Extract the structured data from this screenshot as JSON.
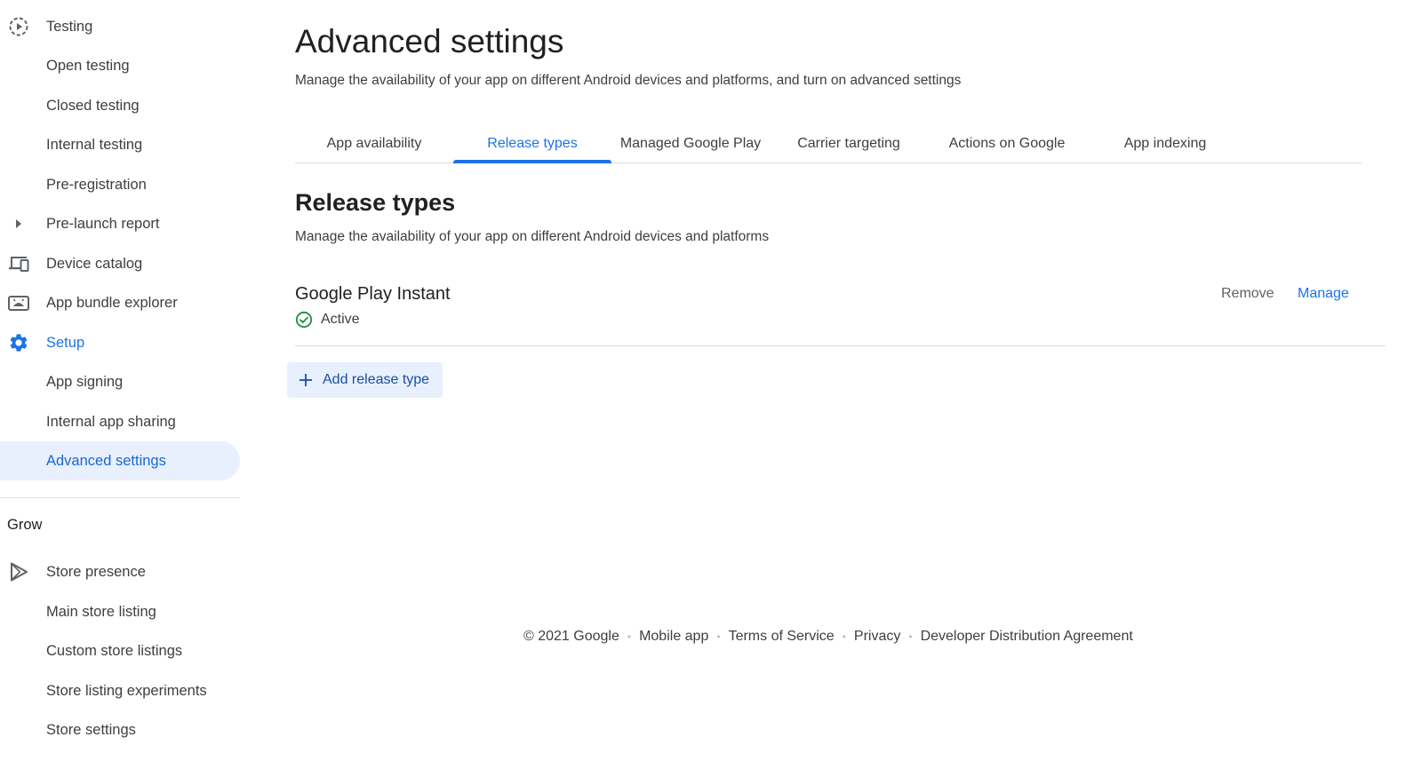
{
  "sidebar": {
    "items": [
      {
        "label": "Testing",
        "icon": "testing-play-icon"
      },
      {
        "label": "Open testing"
      },
      {
        "label": "Closed testing"
      },
      {
        "label": "Internal testing"
      },
      {
        "label": "Pre-registration"
      },
      {
        "label": "Pre-launch report",
        "icon": "caret-right-icon"
      },
      {
        "label": "Device catalog",
        "icon": "devices-icon"
      },
      {
        "label": "App bundle explorer",
        "icon": "android-icon"
      },
      {
        "label": "Setup",
        "icon": "gear-icon"
      },
      {
        "label": "App signing"
      },
      {
        "label": "Internal app sharing"
      },
      {
        "label": "Advanced settings",
        "selected": true
      }
    ],
    "grow_section_label": "Grow",
    "grow_items": [
      {
        "label": "Store presence",
        "icon": "play-store-icon"
      },
      {
        "label": "Main store listing"
      },
      {
        "label": "Custom store listings"
      },
      {
        "label": "Store listing experiments"
      },
      {
        "label": "Store settings"
      }
    ]
  },
  "header": {
    "title": "Advanced settings",
    "description": "Manage the availability of your app on different Android devices and platforms, and turn on advanced settings"
  },
  "tabs": [
    {
      "label": "App availability"
    },
    {
      "label": "Release types",
      "active": true
    },
    {
      "label": "Managed Google Play"
    },
    {
      "label": "Carrier targeting"
    },
    {
      "label": "Actions on Google"
    },
    {
      "label": "App indexing"
    }
  ],
  "release_types": {
    "title": "Release types",
    "description": "Manage the availability of your app on different Android devices and platforms",
    "items": [
      {
        "name": "Google Play Instant",
        "status": "Active",
        "remove_label": "Remove",
        "manage_label": "Manage"
      }
    ],
    "add_label": "Add release type"
  },
  "footer": {
    "copyright": "© 2021 Google",
    "links": [
      "Mobile app",
      "Terms of Service",
      "Privacy",
      "Developer Distribution Agreement"
    ],
    "separator": "•"
  },
  "colors": {
    "accent": "#1a73e8",
    "selected_bg": "#e8f0fe",
    "active_status": "#1e8e3e",
    "divider": "#dadce0"
  }
}
